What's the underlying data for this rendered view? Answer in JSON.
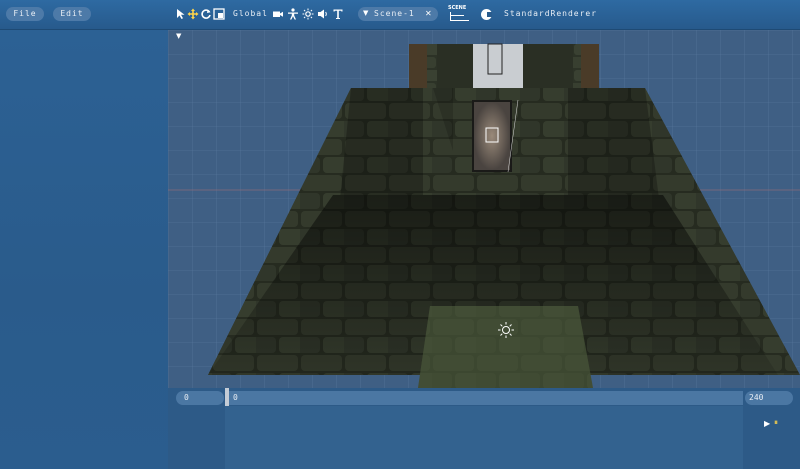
{
  "menu": {
    "file_label": "File",
    "edit_label": "Edit"
  },
  "toolbar": {
    "tools": [
      "select-arrow-icon",
      "move-icon",
      "rotate-icon",
      "scale-icon"
    ],
    "space_label": "Global",
    "add_tools": [
      "camera-icon",
      "figure-icon",
      "sun-icon",
      "speaker-icon",
      "text-icon"
    ],
    "scene_selector": {
      "arrow": "▼",
      "value": "Scene-1",
      "close": "✕"
    },
    "scene_badge": "SCENE",
    "renderer_label": "StandardRenderer"
  },
  "viewport": {
    "dropdown_arrow": "▼"
  },
  "timeline": {
    "start": "0",
    "current": "0",
    "end": "240",
    "play_icon": "▶",
    "pause_icon": "⏸"
  }
}
